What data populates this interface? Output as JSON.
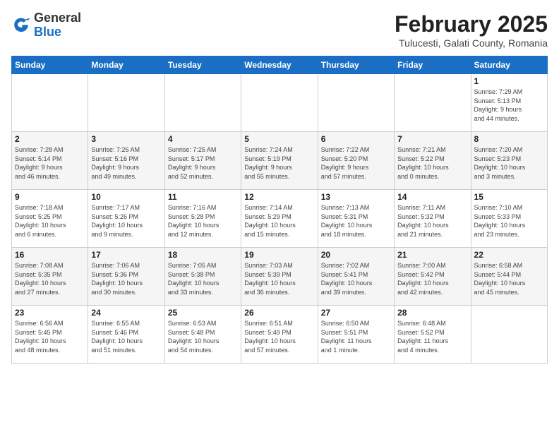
{
  "header": {
    "logo": {
      "general": "General",
      "blue": "Blue"
    },
    "title": "February 2025",
    "subtitle": "Tulucesti, Galati County, Romania"
  },
  "days_of_week": [
    "Sunday",
    "Monday",
    "Tuesday",
    "Wednesday",
    "Thursday",
    "Friday",
    "Saturday"
  ],
  "weeks": [
    [
      {
        "day": "",
        "info": ""
      },
      {
        "day": "",
        "info": ""
      },
      {
        "day": "",
        "info": ""
      },
      {
        "day": "",
        "info": ""
      },
      {
        "day": "",
        "info": ""
      },
      {
        "day": "",
        "info": ""
      },
      {
        "day": "1",
        "info": "Sunrise: 7:29 AM\nSunset: 5:13 PM\nDaylight: 9 hours\nand 44 minutes."
      }
    ],
    [
      {
        "day": "2",
        "info": "Sunrise: 7:28 AM\nSunset: 5:14 PM\nDaylight: 9 hours\nand 46 minutes."
      },
      {
        "day": "3",
        "info": "Sunrise: 7:26 AM\nSunset: 5:16 PM\nDaylight: 9 hours\nand 49 minutes."
      },
      {
        "day": "4",
        "info": "Sunrise: 7:25 AM\nSunset: 5:17 PM\nDaylight: 9 hours\nand 52 minutes."
      },
      {
        "day": "5",
        "info": "Sunrise: 7:24 AM\nSunset: 5:19 PM\nDaylight: 9 hours\nand 55 minutes."
      },
      {
        "day": "6",
        "info": "Sunrise: 7:22 AM\nSunset: 5:20 PM\nDaylight: 9 hours\nand 57 minutes."
      },
      {
        "day": "7",
        "info": "Sunrise: 7:21 AM\nSunset: 5:22 PM\nDaylight: 10 hours\nand 0 minutes."
      },
      {
        "day": "8",
        "info": "Sunrise: 7:20 AM\nSunset: 5:23 PM\nDaylight: 10 hours\nand 3 minutes."
      }
    ],
    [
      {
        "day": "9",
        "info": "Sunrise: 7:18 AM\nSunset: 5:25 PM\nDaylight: 10 hours\nand 6 minutes."
      },
      {
        "day": "10",
        "info": "Sunrise: 7:17 AM\nSunset: 5:26 PM\nDaylight: 10 hours\nand 9 minutes."
      },
      {
        "day": "11",
        "info": "Sunrise: 7:16 AM\nSunset: 5:28 PM\nDaylight: 10 hours\nand 12 minutes."
      },
      {
        "day": "12",
        "info": "Sunrise: 7:14 AM\nSunset: 5:29 PM\nDaylight: 10 hours\nand 15 minutes."
      },
      {
        "day": "13",
        "info": "Sunrise: 7:13 AM\nSunset: 5:31 PM\nDaylight: 10 hours\nand 18 minutes."
      },
      {
        "day": "14",
        "info": "Sunrise: 7:11 AM\nSunset: 5:32 PM\nDaylight: 10 hours\nand 21 minutes."
      },
      {
        "day": "15",
        "info": "Sunrise: 7:10 AM\nSunset: 5:33 PM\nDaylight: 10 hours\nand 23 minutes."
      }
    ],
    [
      {
        "day": "16",
        "info": "Sunrise: 7:08 AM\nSunset: 5:35 PM\nDaylight: 10 hours\nand 27 minutes."
      },
      {
        "day": "17",
        "info": "Sunrise: 7:06 AM\nSunset: 5:36 PM\nDaylight: 10 hours\nand 30 minutes."
      },
      {
        "day": "18",
        "info": "Sunrise: 7:05 AM\nSunset: 5:38 PM\nDaylight: 10 hours\nand 33 minutes."
      },
      {
        "day": "19",
        "info": "Sunrise: 7:03 AM\nSunset: 5:39 PM\nDaylight: 10 hours\nand 36 minutes."
      },
      {
        "day": "20",
        "info": "Sunrise: 7:02 AM\nSunset: 5:41 PM\nDaylight: 10 hours\nand 39 minutes."
      },
      {
        "day": "21",
        "info": "Sunrise: 7:00 AM\nSunset: 5:42 PM\nDaylight: 10 hours\nand 42 minutes."
      },
      {
        "day": "22",
        "info": "Sunrise: 6:58 AM\nSunset: 5:44 PM\nDaylight: 10 hours\nand 45 minutes."
      }
    ],
    [
      {
        "day": "23",
        "info": "Sunrise: 6:56 AM\nSunset: 5:45 PM\nDaylight: 10 hours\nand 48 minutes."
      },
      {
        "day": "24",
        "info": "Sunrise: 6:55 AM\nSunset: 5:46 PM\nDaylight: 10 hours\nand 51 minutes."
      },
      {
        "day": "25",
        "info": "Sunrise: 6:53 AM\nSunset: 5:48 PM\nDaylight: 10 hours\nand 54 minutes."
      },
      {
        "day": "26",
        "info": "Sunrise: 6:51 AM\nSunset: 5:49 PM\nDaylight: 10 hours\nand 57 minutes."
      },
      {
        "day": "27",
        "info": "Sunrise: 6:50 AM\nSunset: 5:51 PM\nDaylight: 11 hours\nand 1 minute."
      },
      {
        "day": "28",
        "info": "Sunrise: 6:48 AM\nSunset: 5:52 PM\nDaylight: 11 hours\nand 4 minutes."
      },
      {
        "day": "",
        "info": ""
      }
    ]
  ]
}
